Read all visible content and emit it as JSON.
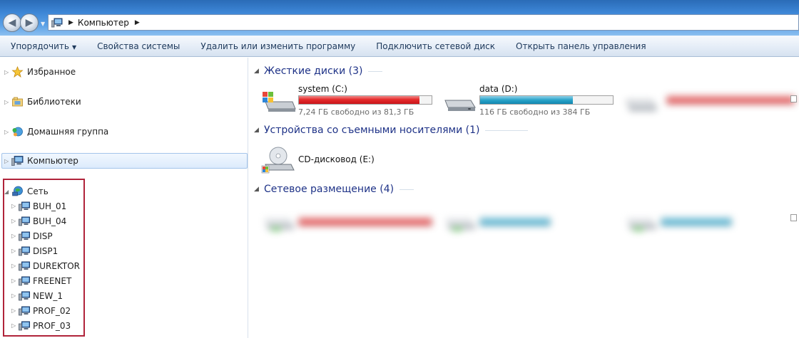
{
  "address": {
    "crumb": "Компьютер"
  },
  "toolbar": {
    "organize": "Упорядочить",
    "system_props": "Свойства системы",
    "uninstall": "Удалить или изменить программу",
    "map_drive": "Подключить сетевой диск",
    "control_panel": "Открыть панель управления"
  },
  "nav": {
    "favorites": "Избранное",
    "libraries": "Библиотеки",
    "homegroup": "Домашняя группа",
    "computer": "Компьютер",
    "network": "Сеть",
    "network_items": [
      "BUH_01",
      "BUH_04",
      "DISP",
      "DISP1",
      "DUREKTOR",
      "FREENET",
      "NEW_1",
      "PROF_02",
      "PROF_03"
    ]
  },
  "groups": {
    "hard_drives": "Жесткие диски (3)",
    "removable": "Устройства со съемными носителями (1)",
    "network": "Сетевое размещение (4)"
  },
  "drives": {
    "c": {
      "name": "system (C:)",
      "free": "7,24 ГБ свободно из 81,3 ГБ",
      "used_fraction": 0.91
    },
    "d": {
      "name": "data (D:)",
      "free": "116 ГБ свободно из 384 ГБ",
      "used_fraction": 0.7
    },
    "e": {
      "name": "CD-дисковод (E:)"
    }
  },
  "colors": {
    "accent": "#1e3287",
    "highlight": "#b0233a",
    "bar_red": "#e52b2b",
    "bar_blue": "#2aa3c9"
  }
}
